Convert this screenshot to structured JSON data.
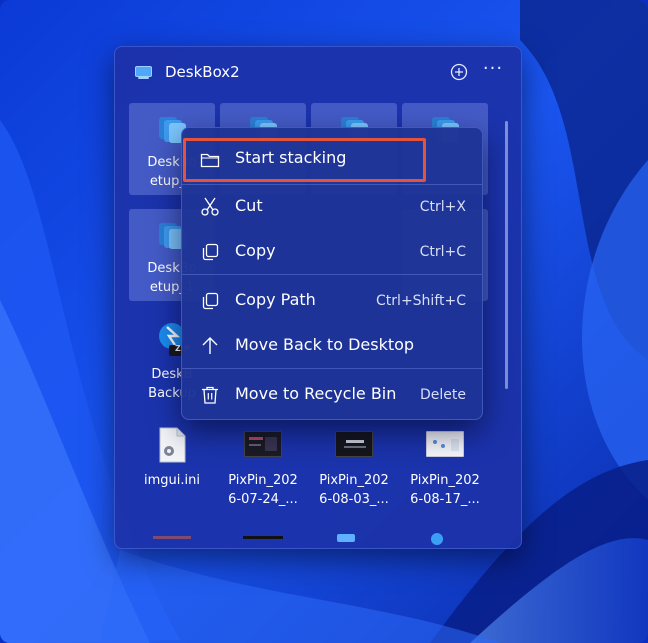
{
  "panel": {
    "title": "DeskBox2",
    "add_icon": "plus-circle-icon",
    "more_icon": "more-dots-icon",
    "more_label": "···"
  },
  "tiles": [
    {
      "label": "DeskBo\netup_1",
      "icon": "stack-icon"
    },
    {
      "label": "",
      "icon": "stack-icon"
    },
    {
      "label": "",
      "icon": "stack-icon"
    },
    {
      "label": "",
      "icon": "stack-icon"
    },
    {
      "label": "DeskBo\netup_1",
      "icon": "stack-icon"
    },
    {
      "label": "DeskB\nBackup",
      "icon": "zip-icon"
    },
    {
      "label": "imgui.ini",
      "icon": "ini-file-icon"
    },
    {
      "label": "PixPin_202\n6-07-24_...",
      "icon": "screenshot-thumb-icon"
    },
    {
      "label": "PixPin_202\n6-08-03_...",
      "icon": "screenshot-thumb-icon"
    },
    {
      "label": "PixPin_202\n6-08-17_...",
      "icon": "screenshot-thumb-icon"
    }
  ],
  "zip_badge": "ZIP",
  "menu": {
    "items": [
      {
        "label": "Start stacking",
        "shortcut": "",
        "icon": "folder-icon"
      },
      {
        "label": "Cut",
        "shortcut": "Ctrl+X",
        "icon": "scissors-icon"
      },
      {
        "label": "Copy",
        "shortcut": "Ctrl+C",
        "icon": "copy-icon"
      },
      {
        "label": "Copy Path",
        "shortcut": "Ctrl+Shift+C",
        "icon": "copy-path-icon"
      },
      {
        "label": "Move Back to Desktop",
        "shortcut": "",
        "icon": "arrow-up-icon"
      },
      {
        "label": "Move to Recycle Bin",
        "shortcut": "Delete",
        "icon": "trash-icon"
      }
    ]
  },
  "colors": {
    "accent_highlight": "#e5533b",
    "wallpaper": "#0a2fc4"
  }
}
